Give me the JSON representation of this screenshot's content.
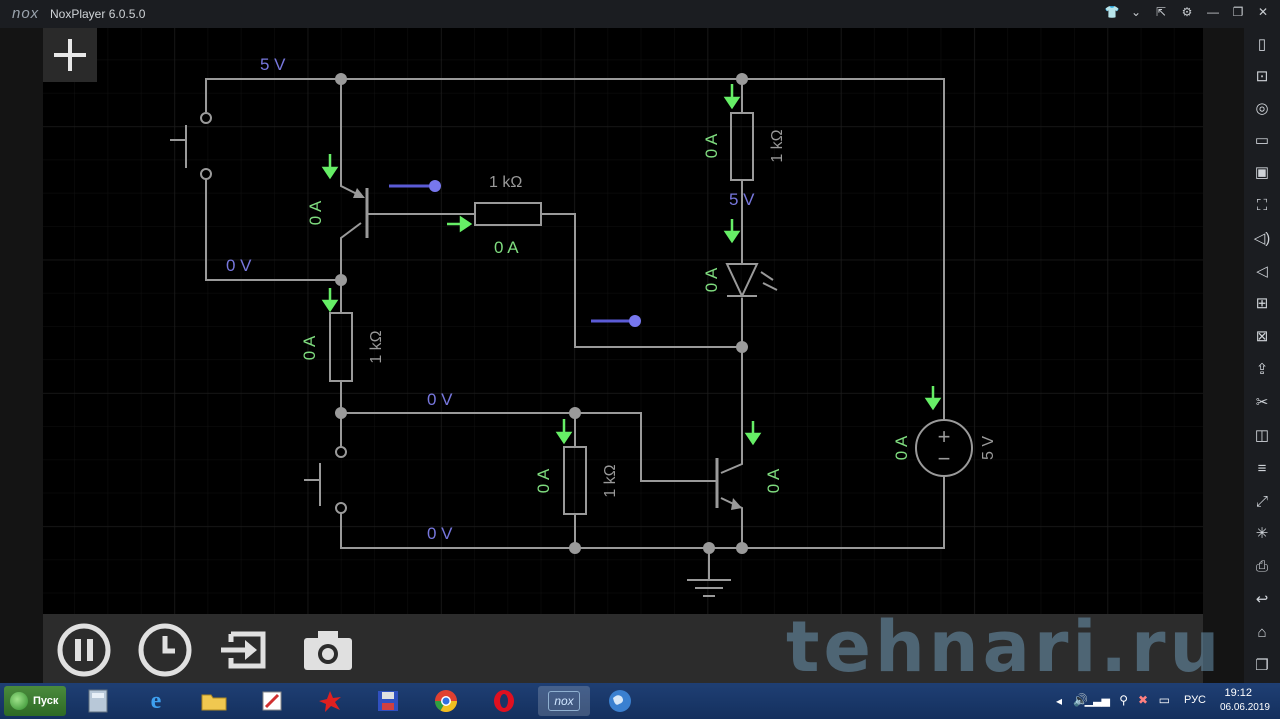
{
  "window": {
    "logo": "nox",
    "title": "NoxPlayer 6.0.5.0",
    "controls": [
      "shirt-icon",
      "chevron-down-icon",
      "pin-icon",
      "gear-icon",
      "minimize-icon",
      "restore-icon",
      "close-icon"
    ]
  },
  "sidebar": {
    "icons": [
      "phone-icon",
      "robot-icon",
      "location-icon",
      "keyboard-icon",
      "screenshot-icon",
      "fullscreen-icon",
      "volume-up-icon",
      "volume-down-icon",
      "apk-install-icon",
      "multi-instance-icon",
      "import-icon",
      "scissors-icon",
      "app-list-icon",
      "menu-icon",
      "shake-icon",
      "loading-icon",
      "printer-icon",
      "back-icon",
      "home-icon",
      "recent-apps-icon"
    ]
  },
  "circuit": {
    "voltage_labels": [
      "5 V",
      "0 V",
      "0 V",
      "0 V",
      "5 V",
      "5 V"
    ],
    "current_labels": [
      "0 A",
      "0 A",
      "0 A",
      "0 A",
      "0 A",
      "0 A",
      "0 A",
      "0 A"
    ],
    "resistor_labels": [
      "1 kΩ",
      "1 kΩ",
      "1 kΩ",
      "1 kΩ"
    ]
  },
  "toolbar": {
    "buttons": [
      "pause-icon",
      "clock-icon",
      "export-icon",
      "camera-icon"
    ]
  },
  "watermark": "tehnari.ru",
  "taskbar": {
    "start_label": "Пуск",
    "apps": [
      "calculator",
      "internet-explorer",
      "folder",
      "paint",
      "splash",
      "floppy",
      "chrome",
      "opera",
      "nox",
      "globe"
    ],
    "language": "РУС",
    "time": "19:12",
    "date": "06.06.2019"
  }
}
